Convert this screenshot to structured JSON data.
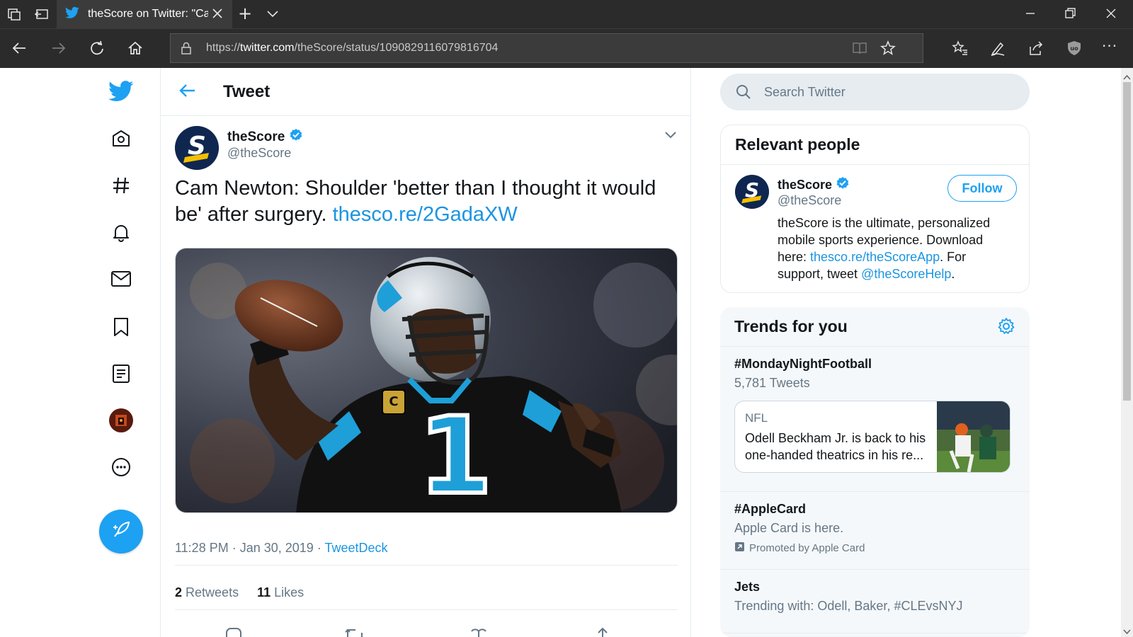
{
  "browser": {
    "tab_title": "theScore on Twitter: \"Ca",
    "url_prefix": "https://",
    "url_host": "twitter.com",
    "url_path": "/theScore/status/1090829116079816704",
    "new_tab_glyph": "+",
    "tab_list_glyph": "⌵",
    "more_glyph": "···"
  },
  "header": {
    "title": "Tweet"
  },
  "tweet": {
    "name": "theScore",
    "handle": "@theScore",
    "text": "Cam Newton: Shoulder 'better than I thought it would be' after surgery. ",
    "link": "thesco.re/2GadaXW",
    "time": "11:28 PM · Jan 30, 2019 · ",
    "source": "TweetDeck",
    "retweets_count": "2",
    "retweets_label": "Retweets",
    "likes_count": "11",
    "likes_label": "Likes",
    "jersey_number": "1"
  },
  "search": {
    "placeholder": "Search Twitter"
  },
  "relevant_people": {
    "title": "Relevant people",
    "name": "theScore",
    "handle": "@theScore",
    "follow_label": "Follow",
    "bio_1": "theScore is the ultimate, personalized mobile sports experience. Download here: ",
    "bio_link_1": "thesco.re/theScoreApp",
    "bio_2": ". For support, tweet ",
    "bio_link_2": "@theScoreHelp",
    "bio_3": "."
  },
  "trends": {
    "title": "Trends for you",
    "items": [
      {
        "name": "#MondayNightFootball",
        "sub": "5,781 Tweets"
      },
      {
        "name": "#AppleCard",
        "sub": "Apple Card is here.",
        "promo": "Promoted by Apple Card"
      },
      {
        "name": "Jets",
        "sub": "Trending with: Odell, Baker, #CLEvsNYJ"
      }
    ],
    "news": {
      "category": "NFL",
      "text": "Odell Beckham Jr. is back to his one-handed theatrics in his re..."
    }
  },
  "colors": {
    "twitter_blue": "#1da1f2",
    "link_blue": "#1b95e0",
    "verified": "#1da1f2",
    "chrome_dark": "#2b2b2b"
  }
}
